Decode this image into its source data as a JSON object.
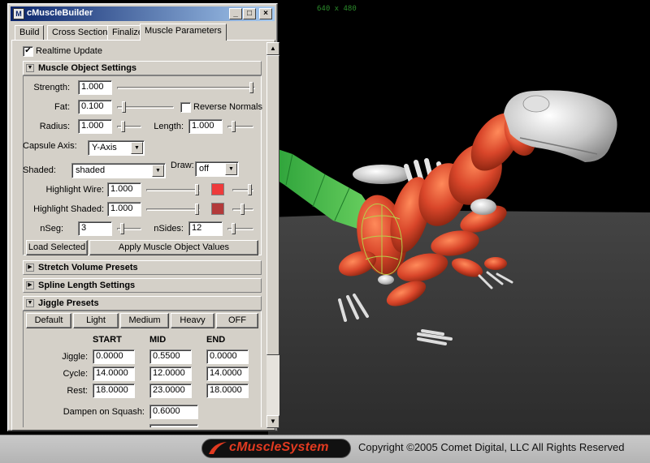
{
  "viewport": {
    "resolution_label": "640 x 480"
  },
  "banner": {
    "logo_text": "cMuscleSystem",
    "copyright": "Copyright ©2005 Comet Digital, LLC  All Rights Reserved"
  },
  "window": {
    "title": "cMuscleBuilder",
    "icon_glyph": "M",
    "controls": {
      "minimize": "_",
      "maximize": "□",
      "close": "×"
    }
  },
  "tabs": [
    {
      "label": "Build"
    },
    {
      "label": "Cross Section"
    },
    {
      "label": "Finalize"
    },
    {
      "label": "Muscle Parameters"
    }
  ],
  "realtime_update": {
    "label": "Realtime Update",
    "checked": "✔"
  },
  "muscle_object_settings": {
    "header": "Muscle Object Settings",
    "strength": {
      "label": "Strength:",
      "value": "1.000"
    },
    "fat": {
      "label": "Fat:",
      "value": "0.100"
    },
    "reverse_normals": {
      "label": "Reverse Normals",
      "checked": ""
    },
    "radius": {
      "label": "Radius:",
      "value": "1.000"
    },
    "length": {
      "label": "Length:",
      "value": "1.000"
    },
    "capsule_axis": {
      "label": "Capsule Axis:",
      "value": "Y-Axis"
    },
    "shaded": {
      "label": "Shaded:",
      "value": "shaded"
    },
    "draw": {
      "label": "Draw:",
      "value": "off"
    },
    "highlight_wire": {
      "label": "Highlight Wire:",
      "value": "1.000",
      "color": "#ee3b3b"
    },
    "highlight_shaded": {
      "label": "Highlight Shaded:",
      "value": "1.000",
      "color": "#b33a3a"
    },
    "nseg": {
      "label": "nSeg:",
      "value": "3"
    },
    "nsides": {
      "label": "nSides:",
      "value": "12"
    },
    "load_selected_label": "Load Selected",
    "apply_label": "Apply Muscle Object Values"
  },
  "stretch_volume_presets": {
    "header": "Stretch Volume Presets"
  },
  "spline_length_settings": {
    "header": "Spline Length Settings"
  },
  "jiggle_presets": {
    "header": "Jiggle Presets",
    "buttons": [
      "Default",
      "Light",
      "Medium",
      "Heavy",
      "OFF"
    ],
    "columns": [
      "START",
      "MID",
      "END"
    ],
    "rows": [
      {
        "label": "Jiggle:",
        "values": [
          "0.0000",
          "0.5500",
          "0.0000"
        ]
      },
      {
        "label": "Cycle:",
        "values": [
          "14.0000",
          "12.0000",
          "14.0000"
        ]
      },
      {
        "label": "Rest:",
        "values": [
          "18.0000",
          "23.0000",
          "18.0000"
        ]
      }
    ],
    "dampen_on_squash": {
      "label": "Dampen on Squash:",
      "value": "0.6000"
    }
  },
  "icons": {
    "expanded_arrow": "▼",
    "collapsed_arrow": "▶",
    "dropdown_arrow": "▼",
    "scroll_up": "▲",
    "scroll_down": "▼"
  },
  "colors": {
    "ui_face": "#d4d0c8",
    "titlebar": "#0a246a",
    "logo_red": "#e13a20",
    "muscle": "#d9462a",
    "dino_skin": "#d0d0d0",
    "tail_green": "#33b040",
    "ground": "#3a3a3a"
  }
}
